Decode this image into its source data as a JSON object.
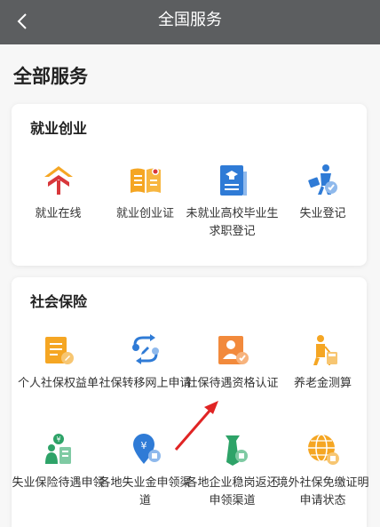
{
  "header": {
    "title": "全国服务",
    "back_icon": "chevron-left-icon"
  },
  "main": {
    "heading": "全部服务"
  },
  "employment": {
    "title": "就业创业",
    "items": [
      {
        "label": "就业在线",
        "icon": "employment-online-icon"
      },
      {
        "label": "就业创业证",
        "icon": "certificate-book-icon"
      },
      {
        "label": "未就业高校毕业生求职登记",
        "icon": "graduate-document-icon"
      },
      {
        "label": "失业登记",
        "icon": "unemployment-person-icon"
      }
    ]
  },
  "insurance": {
    "title": "社会保险",
    "items": [
      {
        "label": "个人社保权益单",
        "icon": "rights-document-icon"
      },
      {
        "label": "社保转移网上申请",
        "icon": "transfer-arrows-icon"
      },
      {
        "label": "社保待遇资格认证",
        "icon": "qualification-verify-icon"
      },
      {
        "label": "养老金测算",
        "icon": "pension-calc-icon"
      },
      {
        "label": "失业保险待遇申领",
        "icon": "unemployment-benefit-icon"
      },
      {
        "label": "各地失业金申领渠道",
        "icon": "unemployment-fund-icon"
      },
      {
        "label": "各地企业稳岗返还申领渠道",
        "icon": "job-stability-icon"
      },
      {
        "label": "境外社保免缴证明申请状态",
        "icon": "overseas-exemption-icon"
      }
    ]
  },
  "colors": {
    "header_bg": "#5c5e60",
    "accent_orange": "#f5a623",
    "accent_blue": "#2f7bd6",
    "accent_green": "#2ea368",
    "accent_red": "#d8373b"
  }
}
